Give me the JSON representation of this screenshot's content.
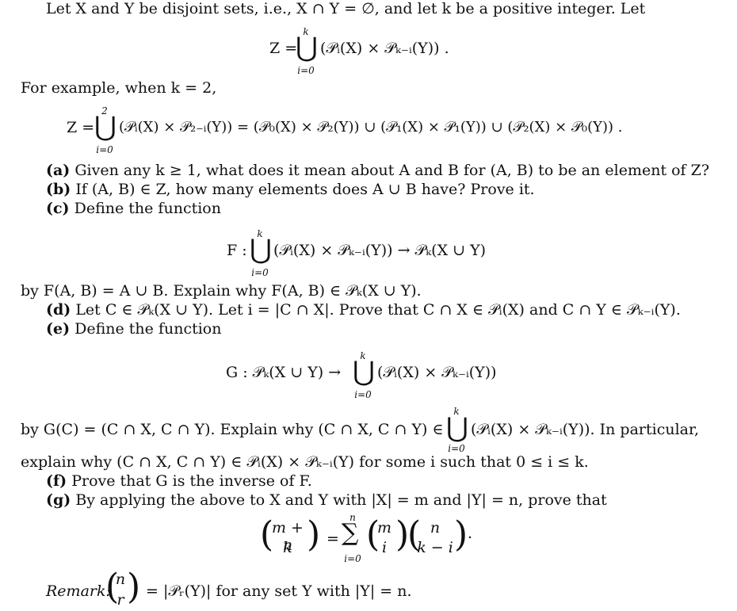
{
  "intro": {
    "line1": "Let X and Y be disjoint sets, i.e., X ∩ Y = ∅, and let k be a positive integer. Let",
    "eq1_lhs": "Z =",
    "eq1_body": "(𝒫ᵢ(X) × 𝒫ₖ₋ᵢ(Y)) .",
    "eq1_upper": "k",
    "eq1_lower": "i=0"
  },
  "example": {
    "line": "For example, when k = 2,",
    "eq_lhs": "Z =",
    "eq_body": "(𝒫ᵢ(X) × 𝒫₂₋ᵢ(Y)) = (𝒫₀(X) × 𝒫₂(Y)) ∪ (𝒫₁(X) × 𝒫₁(Y)) ∪ (𝒫₂(X) × 𝒫₀(Y)) .",
    "eq_upper": "2",
    "eq_lower": "i=0"
  },
  "parts": {
    "a_label": "(a)",
    "a_text": "Given any k ≥ 1, what does it mean about A and B for (A, B) to be an element of Z?",
    "b_label": "(b)",
    "b_text": "If (A, B) ∈ Z, how many elements does A ∪ B have? Prove it.",
    "c_label": "(c)",
    "c_text": "Define the function",
    "c_eq_lhs": "F :",
    "c_eq_body": "(𝒫ᵢ(X) × 𝒫ₖ₋ᵢ(Y)) → 𝒫ₖ(X ∪ Y)",
    "c_upper": "k",
    "c_lower": "i=0",
    "c_after": "by F(A, B) = A ∪ B. Explain why F(A, B) ∈ 𝒫ₖ(X ∪ Y).",
    "d_label": "(d)",
    "d_text": "Let C ∈ 𝒫ₖ(X ∪ Y). Let i = |C ∩ X|. Prove that C ∩ X ∈ 𝒫ᵢ(X) and C ∩ Y ∈ 𝒫ₖ₋ᵢ(Y).",
    "e_label": "(e)",
    "e_text": "Define the function",
    "e_eq_lhs": "G : 𝒫ₖ(X ∪ Y) →",
    "e_eq_body": "(𝒫ᵢ(X) × 𝒫ₖ₋ᵢ(Y))",
    "e_upper": "k",
    "e_lower": "i=0",
    "e_after_a": "by G(C) = (C ∩ X, C ∩ Y). Explain why (C ∩ X, C ∩ Y) ∈",
    "e_after_b": "(𝒫ᵢ(X) × 𝒫ₖ₋ᵢ(Y)).  In particular,",
    "e_after_upper": "k",
    "e_after_lower": "i=0",
    "e_after2": "explain why (C ∩ X, C ∩ Y) ∈ 𝒫ᵢ(X) × 𝒫ₖ₋ᵢ(Y) for some i such that 0 ≤ i ≤ k.",
    "f_label": "(f)",
    "f_text": "Prove that G is the inverse of F.",
    "g_label": "(g)",
    "g_text": "By applying the above to X and Y with |X| = m and |Y| = n, prove that",
    "g_eq": {
      "lhs_top": "m + n",
      "lhs_bot": "k",
      "equals": "=",
      "sum_upper": "n",
      "sum_lower": "i=0",
      "b1_top": "m",
      "b1_bot": "i",
      "b2_top": "n",
      "b2_bot": "k − i",
      "period": "."
    }
  },
  "remark": {
    "label": "Remark:",
    "top": "n",
    "bot": "r",
    "text": "= |𝒫ᵣ(Y)| for any set Y with |Y| = n."
  }
}
